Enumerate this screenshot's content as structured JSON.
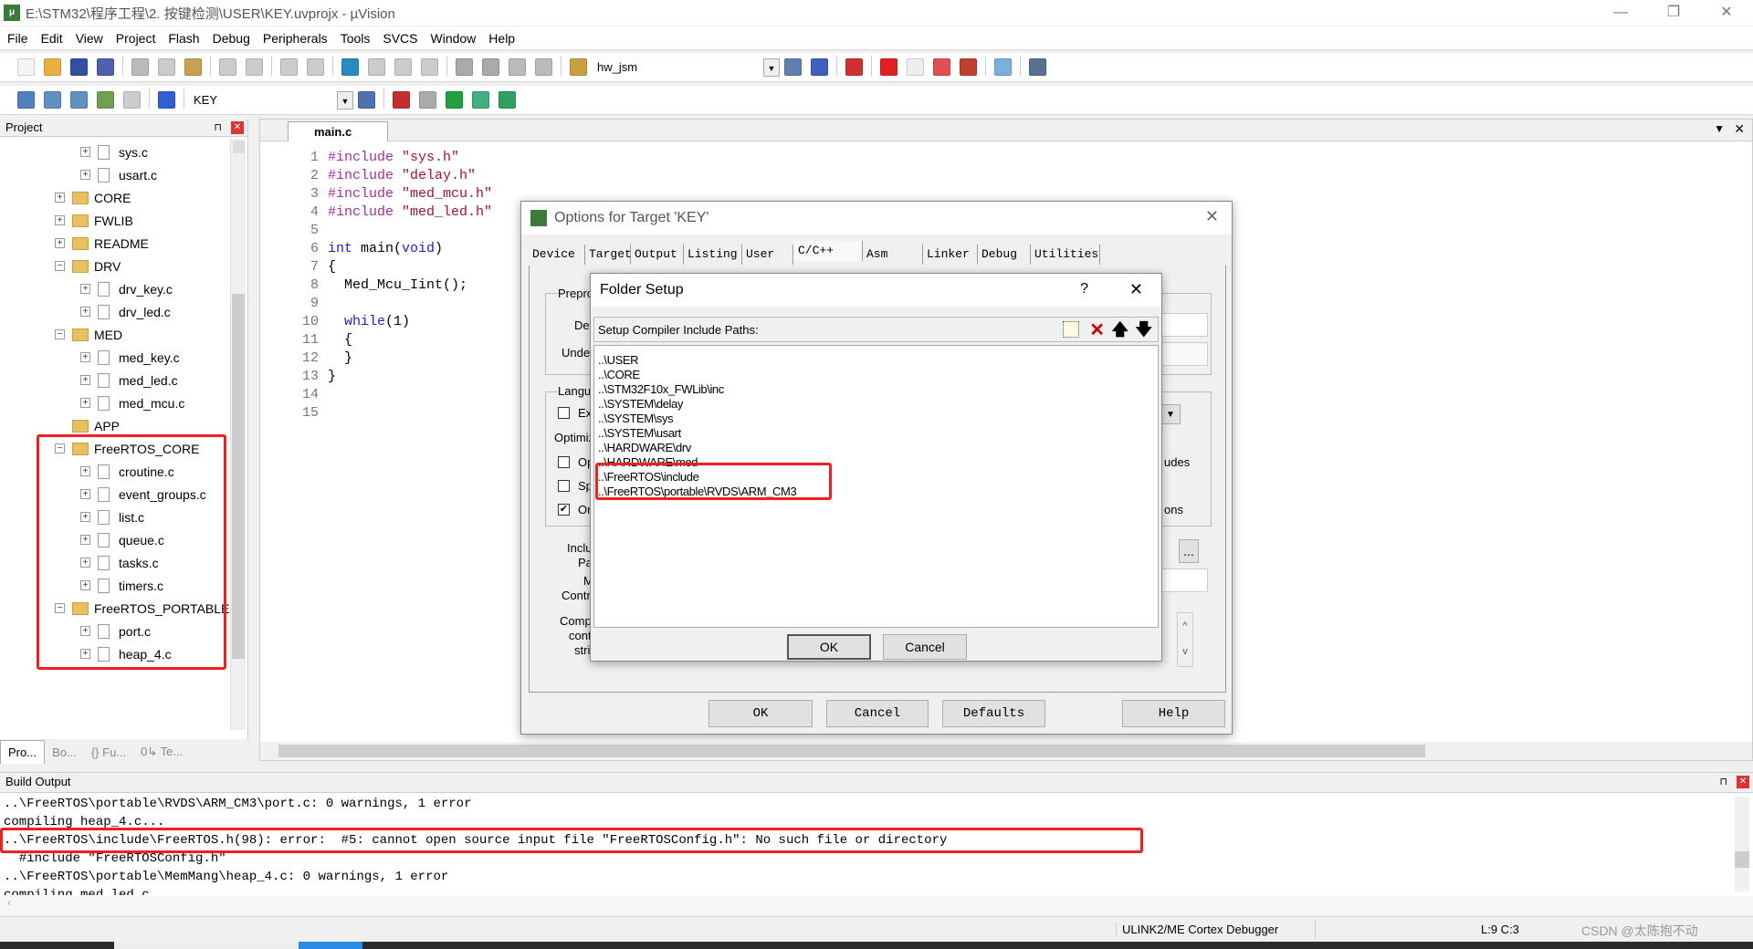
{
  "window": {
    "title": "E:\\STM32\\程序工程\\2. 按键检测\\USER\\KEY.uvprojx - µVision",
    "minimize": "—",
    "maximize": "❐",
    "close": "✕"
  },
  "menu": [
    "File",
    "Edit",
    "View",
    "Project",
    "Flash",
    "Debug",
    "Peripherals",
    "Tools",
    "SVCS",
    "Window",
    "Help"
  ],
  "toolbar1": {
    "icons": [
      [
        "new-file-icon",
        "#f4f4f4"
      ],
      [
        "open-folder-icon",
        "#e8b040"
      ],
      [
        "save-icon",
        "#3050a0"
      ],
      [
        "save-all-icon",
        "#5060b0"
      ],
      [
        "sep"
      ],
      [
        "cut-icon",
        "#bbb"
      ],
      [
        "copy-icon",
        "#ccc"
      ],
      [
        "paste-icon",
        "#c8a050"
      ],
      [
        "sep"
      ],
      [
        "undo-icon",
        "#ccc"
      ],
      [
        "redo-icon",
        "#ccc"
      ],
      [
        "sep"
      ],
      [
        "back-icon",
        "#ccc"
      ],
      [
        "forward-icon",
        "#ccc"
      ],
      [
        "sep"
      ],
      [
        "bookmark-icon",
        "#2a8ac0"
      ],
      [
        "prev-bookmark-icon",
        "#ccc"
      ],
      [
        "next-bookmark-icon",
        "#ccc"
      ],
      [
        "clear-bookmarks-icon",
        "#ccc"
      ],
      [
        "sep"
      ],
      [
        "indent-icon",
        "#aaa"
      ],
      [
        "unindent-icon",
        "#aaa"
      ],
      [
        "comment-icon",
        "#bbb"
      ],
      [
        "uncomment-icon",
        "#bbb"
      ],
      [
        "sep"
      ],
      [
        "find-in-files-icon",
        "#c8a040"
      ]
    ],
    "search_value": "hw_jsm",
    "icons2": [
      [
        "find-icon",
        "#6080b0"
      ],
      [
        "debug-find-icon",
        "#4060c0"
      ],
      [
        "sep"
      ],
      [
        "start-debug-icon",
        "#d03030"
      ],
      [
        "sep"
      ],
      [
        "breakpoint-icon",
        "#e02020"
      ],
      [
        "disable-breakpoint-icon",
        "#eee"
      ],
      [
        "disable-all-breakpoints-icon",
        "#e05050"
      ],
      [
        "kill-breakpoints-icon",
        "#c04030"
      ],
      [
        "sep"
      ],
      [
        "window-layout-icon",
        "#7ab0e0"
      ],
      [
        "sep"
      ],
      [
        "configure-icon",
        "#5a7090"
      ]
    ]
  },
  "toolbar2": {
    "icons": [
      [
        "translate-icon",
        "#5080c0"
      ],
      [
        "build-icon",
        "#6090c0"
      ],
      [
        "rebuild-icon",
        "#6090c0"
      ],
      [
        "batch-build-icon",
        "#70a050"
      ],
      [
        "stop-build-icon",
        "#ccc"
      ],
      [
        "sep"
      ],
      [
        "download-icon",
        "#3060d0"
      ],
      [
        "sep"
      ]
    ],
    "target_value": "KEY",
    "icons2": [
      [
        "target-options-icon",
        "#5070b0"
      ],
      [
        "sep"
      ],
      [
        "manage-components-icon",
        "#c03030"
      ],
      [
        "components-icon",
        "#aaa"
      ],
      [
        "select-pack-icon",
        "#20a040"
      ],
      [
        "pack-installer-icon",
        "#40b080"
      ],
      [
        "runtime-env-icon",
        "#30a060"
      ]
    ]
  },
  "project": {
    "title": "Project",
    "pin": "⊓",
    "close": "✕",
    "tree": [
      {
        "label": "sys.c",
        "level": 1,
        "type": "file",
        "exp": "+"
      },
      {
        "label": "usart.c",
        "level": 1,
        "type": "file",
        "exp": "+"
      },
      {
        "label": "CORE",
        "level": 0,
        "type": "folder",
        "exp": "+"
      },
      {
        "label": "FWLIB",
        "level": 0,
        "type": "folder",
        "exp": "+"
      },
      {
        "label": "README",
        "level": 0,
        "type": "folder",
        "exp": "+"
      },
      {
        "label": "DRV",
        "level": 0,
        "type": "folder",
        "exp": "−"
      },
      {
        "label": "drv_key.c",
        "level": 1,
        "type": "file",
        "exp": "+"
      },
      {
        "label": "drv_led.c",
        "level": 1,
        "type": "file",
        "exp": "+"
      },
      {
        "label": "MED",
        "level": 0,
        "type": "folder",
        "exp": "−"
      },
      {
        "label": "med_key.c",
        "level": 1,
        "type": "file",
        "exp": "+"
      },
      {
        "label": "med_led.c",
        "level": 1,
        "type": "file",
        "exp": "+"
      },
      {
        "label": "med_mcu.c",
        "level": 1,
        "type": "file",
        "exp": "+"
      },
      {
        "label": "APP",
        "level": 0,
        "type": "folder",
        "exp": ""
      },
      {
        "label": "FreeRTOS_CORE",
        "level": 0,
        "type": "folder",
        "exp": "−"
      },
      {
        "label": "croutine.c",
        "level": 1,
        "type": "file",
        "exp": "+"
      },
      {
        "label": "event_groups.c",
        "level": 1,
        "type": "file",
        "exp": "+"
      },
      {
        "label": "list.c",
        "level": 1,
        "type": "file",
        "exp": "+"
      },
      {
        "label": "queue.c",
        "level": 1,
        "type": "file",
        "exp": "+"
      },
      {
        "label": "tasks.c",
        "level": 1,
        "type": "file",
        "exp": "+"
      },
      {
        "label": "timers.c",
        "level": 1,
        "type": "file",
        "exp": "+"
      },
      {
        "label": "FreeRTOS_PORTABLE",
        "level": 0,
        "type": "folder",
        "exp": "−"
      },
      {
        "label": "port.c",
        "level": 1,
        "type": "file",
        "exp": "+"
      },
      {
        "label": "heap_4.c",
        "level": 1,
        "type": "file",
        "exp": "+"
      }
    ],
    "tabs": [
      "Pro...",
      "Bo...",
      "{} Fu...",
      "0↳ Te..."
    ]
  },
  "editor": {
    "tab": "main.c",
    "menu_arrow": "▼",
    "close": "✕",
    "lines": [
      [
        [
          "pp",
          "#include "
        ],
        [
          "st",
          "\"sys.h\""
        ]
      ],
      [
        [
          "pp",
          "#include "
        ],
        [
          "st",
          "\"delay.h\""
        ]
      ],
      [
        [
          "pp",
          "#include "
        ],
        [
          "st",
          "\"med_mcu.h\""
        ]
      ],
      [
        [
          "pp",
          "#include "
        ],
        [
          "st",
          "\"med_led.h\""
        ]
      ],
      [],
      [
        [
          "kw",
          "int "
        ],
        [
          "",
          "main("
        ],
        [
          "kw",
          "void"
        ],
        [
          "",
          ")"
        ]
      ],
      [
        [
          "",
          "{"
        ]
      ],
      [
        [
          "",
          "  Med_Mcu_Iint();"
        ]
      ],
      [],
      [
        [
          "",
          "  "
        ],
        [
          "kw",
          "while"
        ],
        [
          "",
          "(1)"
        ]
      ],
      [
        [
          "",
          "  {"
        ]
      ],
      [
        [
          "",
          "  }"
        ]
      ],
      [
        [
          "",
          "}"
        ]
      ],
      [],
      []
    ]
  },
  "options_dialog": {
    "title": "Options for Target 'KEY'",
    "close": "✕",
    "tabs": [
      "Device",
      "Target",
      "Output",
      "Listing",
      "User",
      "C/C++",
      "Asm",
      "Linker",
      "Debug",
      "Utilities"
    ],
    "active_tab": "C/C++",
    "fragments": {
      "prepro": "Prepro",
      "def": "Def",
      "undef": "Undef",
      "langu": "Langu",
      "ex": "Ex",
      "optimiz": "Optimiz",
      "op": "Op",
      "sp": "Sp",
      "on": "On",
      "inclu": "Inclu",
      "pat": "Pat",
      "m": "M",
      "contr": "Contr",
      "comp": "Comp",
      "cont": "cont",
      "stri": "stri",
      "udes": "udes",
      "ons": "ons",
      "browse": "...",
      "up": "^",
      "down": "v",
      "dd": "▼"
    },
    "checkboxes": {
      "on_checked": true
    },
    "buttons": {
      "ok": "OK",
      "cancel": "Cancel",
      "defaults": "Defaults",
      "help": "Help"
    }
  },
  "folder_setup": {
    "title": "Folder Setup",
    "help": "?",
    "close": "✕",
    "label": "Setup Compiler Include Paths:",
    "paths": [
      "..\\USER",
      "..\\CORE",
      "..\\STM32F10x_FWLib\\inc",
      "..\\SYSTEM\\delay",
      "..\\SYSTEM\\sys",
      "..\\SYSTEM\\usart",
      "..\\HARDWARE\\drv",
      "..\\HARDWARE\\med",
      "..\\FreeRTOS\\include",
      "..\\FreeRTOS\\portable\\RVDS\\ARM_CM3"
    ],
    "ok": "OK",
    "cancel": "Cancel"
  },
  "build_output": {
    "title": "Build Output",
    "pin": "⊓",
    "close": "✕",
    "lines": [
      "..\\FreeRTOS\\portable\\RVDS\\ARM_CM3\\port.c: 0 warnings, 1 error",
      "compiling heap_4.c...",
      "..\\FreeRTOS\\include\\FreeRTOS.h(98): error:  #5: cannot open source input file \"FreeRTOSConfig.h\": No such file or directory",
      "  #include \"FreeRTOSConfig.h\"",
      "..\\FreeRTOS\\portable\\MemMang\\heap_4.c: 0 warnings, 1 error",
      "compiling med_led.c..."
    ]
  },
  "status": {
    "debugger": "ULINK2/ME Cortex Debugger",
    "position": "L:9 C:3",
    "watermark": "CSDN @太陈抱不动"
  },
  "colors": {
    "highlight_box": "#f02020",
    "accent": "#3a7a3a"
  }
}
